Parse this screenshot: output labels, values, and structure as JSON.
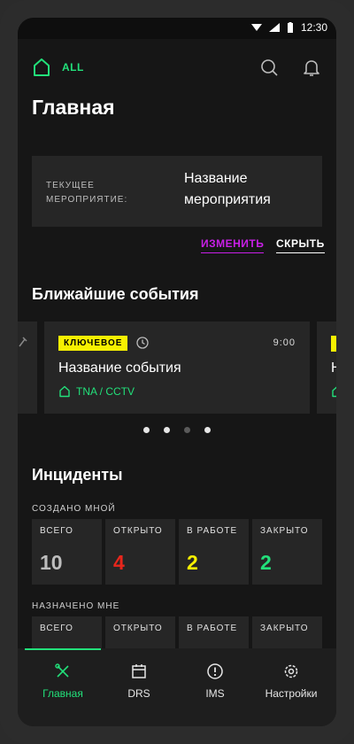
{
  "status_bar": {
    "time": "12:30"
  },
  "header": {
    "filter_label": "ALL",
    "title": "Главная"
  },
  "current_event": {
    "label": "ТЕКУЩЕЕ МЕРОПРИЯТИЕ:",
    "value": "Название мероприятия",
    "change_label": "ИЗМЕНИТЬ",
    "hide_label": "СКРЫТЬ"
  },
  "upcoming": {
    "title": "Ближайшие события",
    "prev_card_fragment": "",
    "cards": [
      {
        "badge": "КЛЮЧЕВОЕ",
        "time": "9:00",
        "name": "Название события",
        "location": "TNA / CCTV"
      }
    ],
    "next_card_name_fragment": "Н",
    "pagination_active": [
      true,
      true,
      false,
      true
    ]
  },
  "incidents": {
    "title": "Инциденты",
    "created": {
      "label": "СОЗДАНО МНОЙ",
      "stats": [
        {
          "label": "ВСЕГО",
          "value": "10",
          "color": "#bdbdbd"
        },
        {
          "label": "ОТКРЫТО",
          "value": "4",
          "color": "#e8261c"
        },
        {
          "label": "В РАБОТЕ",
          "value": "2",
          "color": "#f7f000"
        },
        {
          "label": "ЗАКРЫТО",
          "value": "2",
          "color": "#22e07a"
        }
      ]
    },
    "assigned": {
      "label": "НАЗНАЧЕНО МНЕ",
      "stats": [
        {
          "label": "ВСЕГО"
        },
        {
          "label": "ОТКРЫТО"
        },
        {
          "label": "В РАБОТЕ"
        },
        {
          "label": "ЗАКРЫТО"
        }
      ]
    }
  },
  "nav": [
    {
      "label": "Главная",
      "icon": "home-tools-icon",
      "active": true
    },
    {
      "label": "DRS",
      "icon": "calendar-icon",
      "active": false
    },
    {
      "label": "IMS",
      "icon": "alert-circle-icon",
      "active": false
    },
    {
      "label": "Настройки",
      "icon": "gear-icon",
      "active": false
    }
  ],
  "colors": {
    "accent_green": "#22e07a",
    "accent_magenta": "#c81fe6",
    "badge_yellow": "#f7f000",
    "background": "#161616",
    "card": "#262626"
  }
}
